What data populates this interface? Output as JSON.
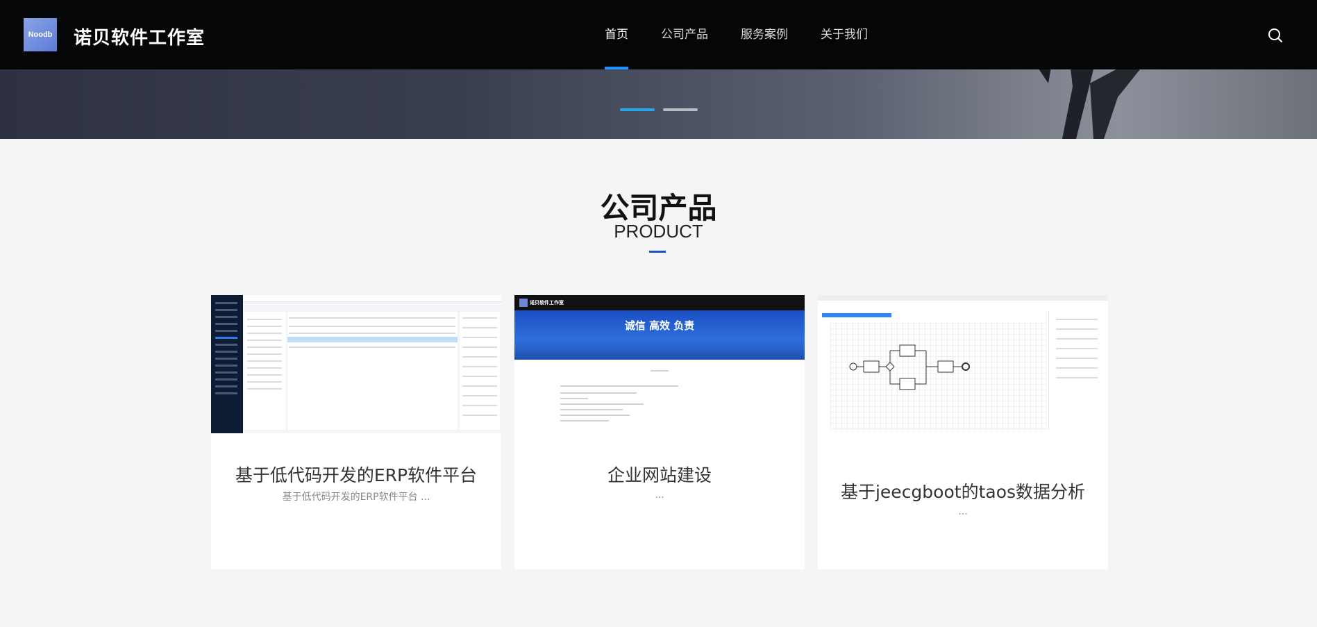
{
  "header": {
    "logo_text": "Noodb",
    "brand": "诺贝软件工作室",
    "nav": [
      {
        "label": "首页",
        "active": true
      },
      {
        "label": "公司产品",
        "active": false
      },
      {
        "label": "服务案例",
        "active": false
      },
      {
        "label": "关于我们",
        "active": false
      }
    ],
    "search_icon": "search-icon"
  },
  "carousel": {
    "slide_count": 2,
    "active_index": 0
  },
  "section": {
    "title": "公司产品",
    "subtitle": "PRODUCT"
  },
  "products": [
    {
      "title": "基于低代码开发的ERP软件平台",
      "desc": "基于低代码开发的ERP软件平台 ..."
    },
    {
      "title": "企业网站建设",
      "desc": "...",
      "thumb_banner": "诚信 高效 负责",
      "thumb_brand": "诺贝软件工作室"
    },
    {
      "title": "基于jeecgboot的taos数据分析",
      "desc": "..."
    }
  ],
  "colors": {
    "header_bg": "#050608",
    "accent": "#1e90ff",
    "section_line": "#1c4fd0",
    "page_bg": "#f5f5f5"
  }
}
